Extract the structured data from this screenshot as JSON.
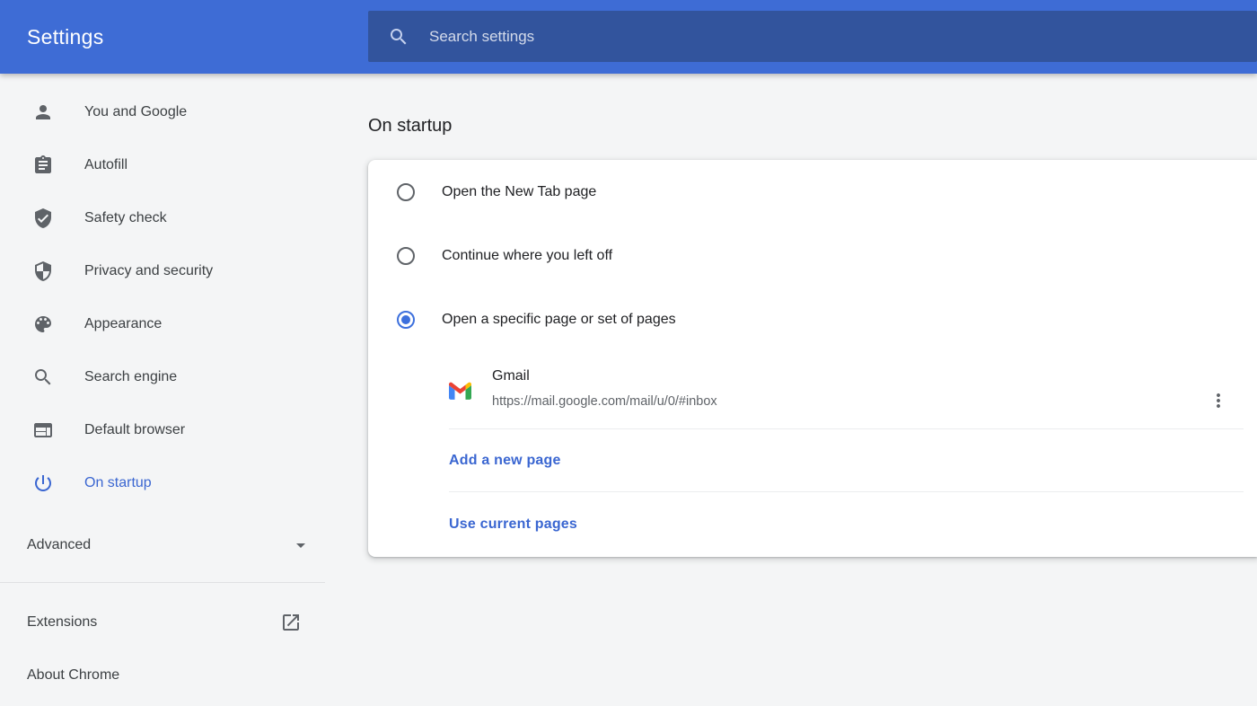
{
  "header": {
    "title": "Settings",
    "search_placeholder": "Search settings"
  },
  "sidebar": {
    "items": [
      {
        "label": "You and Google",
        "icon": "person-icon"
      },
      {
        "label": "Autofill",
        "icon": "clipboard-icon"
      },
      {
        "label": "Safety check",
        "icon": "shield-check-icon"
      },
      {
        "label": "Privacy and security",
        "icon": "shield-half-icon"
      },
      {
        "label": "Appearance",
        "icon": "palette-icon"
      },
      {
        "label": "Search engine",
        "icon": "search-icon"
      },
      {
        "label": "Default browser",
        "icon": "browser-window-icon"
      },
      {
        "label": "On startup",
        "icon": "power-icon"
      }
    ],
    "selected_item": "On startup",
    "advanced_label": "Advanced",
    "extensions_label": "Extensions",
    "about_label": "About Chrome"
  },
  "main": {
    "section_title": "On startup",
    "radio_options": [
      {
        "label": "Open the New Tab page",
        "selected": false
      },
      {
        "label": "Continue where you left off",
        "selected": false
      },
      {
        "label": "Open a specific page or set of pages",
        "selected": true
      }
    ],
    "startup_page": {
      "title": "Gmail",
      "url": "https://mail.google.com/mail/u/0/#inbox"
    },
    "add_page_label": "Add a new page",
    "use_current_label": "Use current pages"
  },
  "colors": {
    "header_bg": "#3e6cd5",
    "search_bg": "#32549d",
    "accent_link": "#3a66d1",
    "radio_selected": "#3d70dd",
    "page_bg": "#f4f5f6",
    "card_bg": "#ffffff",
    "text_primary": "#202124",
    "text_secondary": "#5f6368",
    "gmail_blue": "#4285f4",
    "gmail_green": "#34a853",
    "gmail_yellow": "#fbbc04",
    "gmail_red": "#ea4335"
  }
}
